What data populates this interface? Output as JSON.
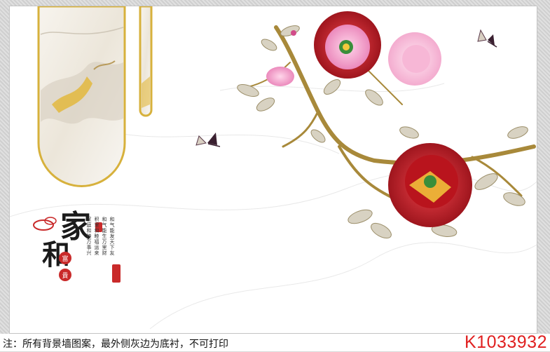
{
  "artwork": {
    "calligraphy": {
      "char1": "家",
      "char2": "和",
      "round_seal1": "富",
      "round_seal2": "貴"
    },
    "poem_columns": [
      "和气能发天下友",
      "和气能生万里财",
      "积里和睦福运来",
      "家庭和睦万事兴"
    ],
    "colors": {
      "gold": "#d7b13c",
      "peony_red": "#c0151e",
      "peony_pink": "#f29ac6",
      "seal_red": "#c92a2a"
    }
  },
  "footer": {
    "note": "注：所有背景墙图案，最外侧灰边为底衬，不可打印",
    "code": "K1033932"
  }
}
